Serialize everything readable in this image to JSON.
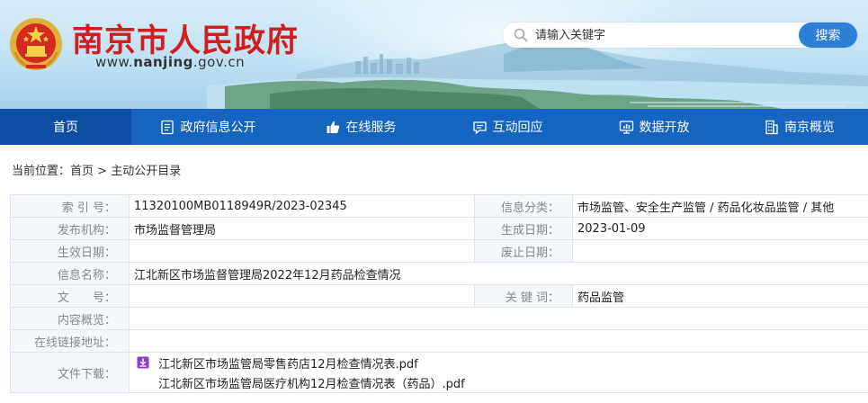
{
  "header": {
    "site_title": "南京市人民政府",
    "site_url_prefix": "www.",
    "site_url_domain": "nanjing",
    "site_url_suffix": ".gov.cn",
    "search_placeholder": "请输入关键字",
    "search_button": "搜索"
  },
  "nav": [
    {
      "label": "首页",
      "icon": "home",
      "active": true
    },
    {
      "label": "政府信息公开",
      "icon": "document-icon"
    },
    {
      "label": "在线服务",
      "icon": "thumbs-up-icon"
    },
    {
      "label": "互动回应",
      "icon": "chat-icon"
    },
    {
      "label": "数据开放",
      "icon": "data-screen-icon"
    },
    {
      "label": "南京概览",
      "icon": "building-icon"
    }
  ],
  "breadcrumb": {
    "prefix": "当前位置：",
    "home": "首页",
    "separator": " > ",
    "current": "主动公开目录"
  },
  "meta": {
    "index_no_label": "索 引 号：",
    "index_no": "11320100MB0118949R/2023-02345",
    "category_label": "信息分类：",
    "category": "市场监管、安全生产监管 / 药品化妆品监管 / 其他",
    "publisher_label": "发布机构：",
    "publisher": "市场监督管理局",
    "created_label": "生成日期：",
    "created": "2023-01-09",
    "effective_label": "生效日期：",
    "effective": "",
    "expired_label": "废止日期：",
    "expired": "",
    "name_label": "信息名称：",
    "name": "江北新区市场监督管理局2022年12月药品检查情况",
    "doc_no_label": "文　　号：",
    "doc_no": "",
    "keywords_label": "关 键 词：",
    "keywords": "药品监管",
    "preview_label": "内容概览：",
    "preview": "",
    "link_label": "在线链接地址：",
    "link": "",
    "download_label": "文件下载：",
    "files": [
      "江北新区市场监管局零售药店12月检查情况表.pdf",
      "江北新区市场监管局医疗机构12月检查情况表（药品）.pdf"
    ]
  },
  "colors": {
    "title_red": "#d11f1f",
    "nav_blue": "#1565c0",
    "nav_active": "#0e4fa3",
    "search_button": "#2e7fd6",
    "download_icon": "#8e3fc4"
  }
}
